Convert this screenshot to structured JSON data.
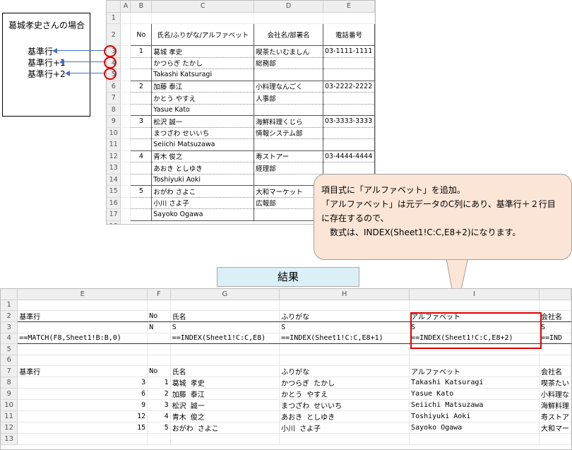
{
  "note": {
    "title": "葛城孝史さんの場合",
    "lines": [
      "基準行",
      "基準行+1",
      "基準行+2"
    ]
  },
  "top_sheet": {
    "col_headers": [
      "",
      "A",
      "B",
      "C",
      "D",
      "E"
    ],
    "table_headers": [
      "No",
      "氏名/ふりがな/アルファベット",
      "会社名/部署名",
      "電話番号"
    ],
    "rows": [
      {
        "num": "1",
        "no": "",
        "name": "",
        "company": "",
        "phone": ""
      },
      {
        "num": "2",
        "no": "No",
        "name": "氏名/ふりがな/アルファベット",
        "company": "会社名/部署名",
        "phone": "電話番号"
      },
      {
        "num": "3",
        "no": "1",
        "name": "葛城 孝史",
        "company": "喫茶たいむましん",
        "phone": "03-1111-1111"
      },
      {
        "num": "4",
        "no": "",
        "name": "かつらぎ たかし",
        "company": "総務部",
        "phone": ""
      },
      {
        "num": "5",
        "no": "",
        "name": "Takashi Katsuragi",
        "company": "",
        "phone": ""
      },
      {
        "num": "6",
        "no": "2",
        "name": "加藤 泰江",
        "company": "小料理なんごく",
        "phone": "03-2222-2222"
      },
      {
        "num": "7",
        "no": "",
        "name": "かとう やすえ",
        "company": "人事部",
        "phone": ""
      },
      {
        "num": "8",
        "no": "",
        "name": "Yasue Kato",
        "company": "",
        "phone": ""
      },
      {
        "num": "9",
        "no": "3",
        "name": "松沢 誠一",
        "company": "海鮮料理くじら",
        "phone": "03-3333-3333"
      },
      {
        "num": "10",
        "no": "",
        "name": "まつざわ せいいち",
        "company": "情報システム部",
        "phone": ""
      },
      {
        "num": "11",
        "no": "",
        "name": "Seiichi Matsuzawa",
        "company": "",
        "phone": ""
      },
      {
        "num": "12",
        "no": "4",
        "name": "青木 俊之",
        "company": "寿ストアー",
        "phone": "03-4444-4444"
      },
      {
        "num": "13",
        "no": "",
        "name": "あおき としゆき",
        "company": "経理部",
        "phone": ""
      },
      {
        "num": "14",
        "no": "",
        "name": "Toshiyuki Aoki",
        "company": "",
        "phone": ""
      },
      {
        "num": "15",
        "no": "5",
        "name": "おがわ さよこ",
        "company": "大和マーケット",
        "phone": ""
      },
      {
        "num": "16",
        "no": "",
        "name": "小川 さよ子",
        "company": "広報部",
        "phone": ""
      },
      {
        "num": "17",
        "no": "",
        "name": "Sayoko Ogawa",
        "company": "",
        "phone": ""
      },
      {
        "num": "18",
        "no": "",
        "name": "",
        "company": "",
        "phone": ""
      }
    ]
  },
  "callout": {
    "lines": [
      "項目式に「アルファベット」を追加。",
      "「アルファベット」は元データのC列にあり、基準行＋２行目",
      "に存在するので、",
      "　数式は、INDEX(Sheet1!C:C,E8+2)になります。"
    ]
  },
  "result_label": "結果",
  "bottom_sheet": {
    "col_headers": [
      "",
      "E",
      "F",
      "G",
      "H",
      "I",
      ""
    ],
    "rows": [
      {
        "num": "1",
        "e": "",
        "f": "",
        "g": "",
        "h": "",
        "i": "",
        "j": ""
      },
      {
        "num": "2",
        "e": "基準行",
        "f": "No",
        "g": "氏名",
        "h": "ふりがな",
        "i": "アルファベット",
        "j": "会社名"
      },
      {
        "num": "3",
        "e": "",
        "f": "N",
        "g": "S",
        "h": "S",
        "i": "S",
        "j": "S"
      },
      {
        "num": "4",
        "e": "==MATCH(F8,Sheet1!B:B,0)",
        "f": "",
        "g": "==INDEX(Sheet1!C:C,E8)",
        "h": "==INDEX(Sheet1!C:C,E8+1)",
        "i": "==INDEX(Sheet1!C:C,E8+2)",
        "j": "==IND"
      },
      {
        "num": "5",
        "e": "",
        "f": "",
        "g": "",
        "h": "",
        "i": "",
        "j": ""
      },
      {
        "num": "6",
        "e": "",
        "f": "",
        "g": "",
        "h": "",
        "i": "",
        "j": ""
      },
      {
        "num": "7",
        "e": "基準行",
        "f": "No",
        "g": "氏名",
        "h": "ふりがな",
        "i": "アルファベット",
        "j": "会社名"
      },
      {
        "num": "8",
        "e": "3",
        "f": "1",
        "g": "葛城 孝史",
        "h": "かつらぎ たかし",
        "i": "Takashi Katsuragi",
        "j": "喫茶たい"
      },
      {
        "num": "9",
        "e": "6",
        "f": "2",
        "g": "加藤 泰江",
        "h": "かとう やすえ",
        "i": "Yasue Kato",
        "j": "小料理な"
      },
      {
        "num": "10",
        "e": "9",
        "f": "3",
        "g": "松沢 誠一",
        "h": "まつざわ せいいち",
        "i": "Seiichi Matsuzawa",
        "j": "海鮮料理"
      },
      {
        "num": "11",
        "e": "12",
        "f": "4",
        "g": "青木 俊之",
        "h": "あおき としゆき",
        "i": "Toshiyuki Aoki",
        "j": "寿ストア"
      },
      {
        "num": "12",
        "e": "15",
        "f": "5",
        "g": "おがわ さよこ",
        "h": "小川 さよ子",
        "i": "Sayoko Ogawa",
        "j": "大和マー"
      },
      {
        "num": "13",
        "e": "",
        "f": "",
        "g": "",
        "h": "",
        "i": "",
        "j": ""
      }
    ]
  }
}
